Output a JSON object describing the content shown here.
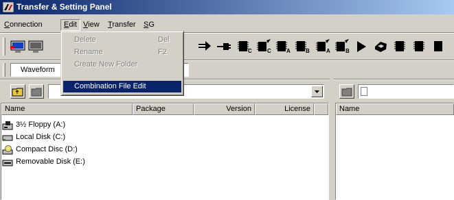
{
  "window": {
    "title": "Transfer & Setting Panel",
    "app_icon": "transfer-panel-icon"
  },
  "menubar": {
    "items": [
      {
        "label": "Connection",
        "mnemonic": "C"
      },
      {
        "label": "Edit",
        "mnemonic": "E"
      },
      {
        "label": "View",
        "mnemonic": "V"
      },
      {
        "label": "Transfer",
        "mnemonic": "T"
      },
      {
        "label": "SG",
        "mnemonic": "S"
      }
    ],
    "open_menu": "Edit"
  },
  "edit_menu": {
    "items": [
      {
        "label": "Delete",
        "shortcut": "Del",
        "enabled": false
      },
      {
        "label": "Rename",
        "shortcut": "F2",
        "enabled": false
      },
      {
        "label": "Create New Folder",
        "shortcut": "",
        "enabled": false
      },
      {
        "label": "Combination File Edit",
        "shortcut": "",
        "enabled": true,
        "highlighted": true
      }
    ]
  },
  "toolbar": {
    "buttons": [
      "monitor-connect-icon",
      "monitor-disconnect-icon",
      "arrow-right-icon",
      "plug-icon",
      "chip-c-icon",
      "chip-write-c-icon",
      "chip-a-icon",
      "chip-b-icon",
      "chip-write-a-icon",
      "chip-write-b-icon",
      "play-icon",
      "globe-icon",
      "chip-icon"
    ],
    "mode_combo": "Waveform"
  },
  "left_pane": {
    "columns": [
      "Name",
      "Package",
      "Version",
      "License"
    ],
    "drives": [
      {
        "label": "3½ Floppy (A:)",
        "icon": "floppy-drive-icon"
      },
      {
        "label": "Local Disk (C:)",
        "icon": "hard-disk-icon"
      },
      {
        "label": "Compact Disc (D:)",
        "icon": "cd-drive-icon"
      },
      {
        "label": "Removable Disk (E:)",
        "icon": "removable-disk-icon"
      }
    ]
  },
  "right_pane": {
    "columns": [
      "Name"
    ]
  }
}
